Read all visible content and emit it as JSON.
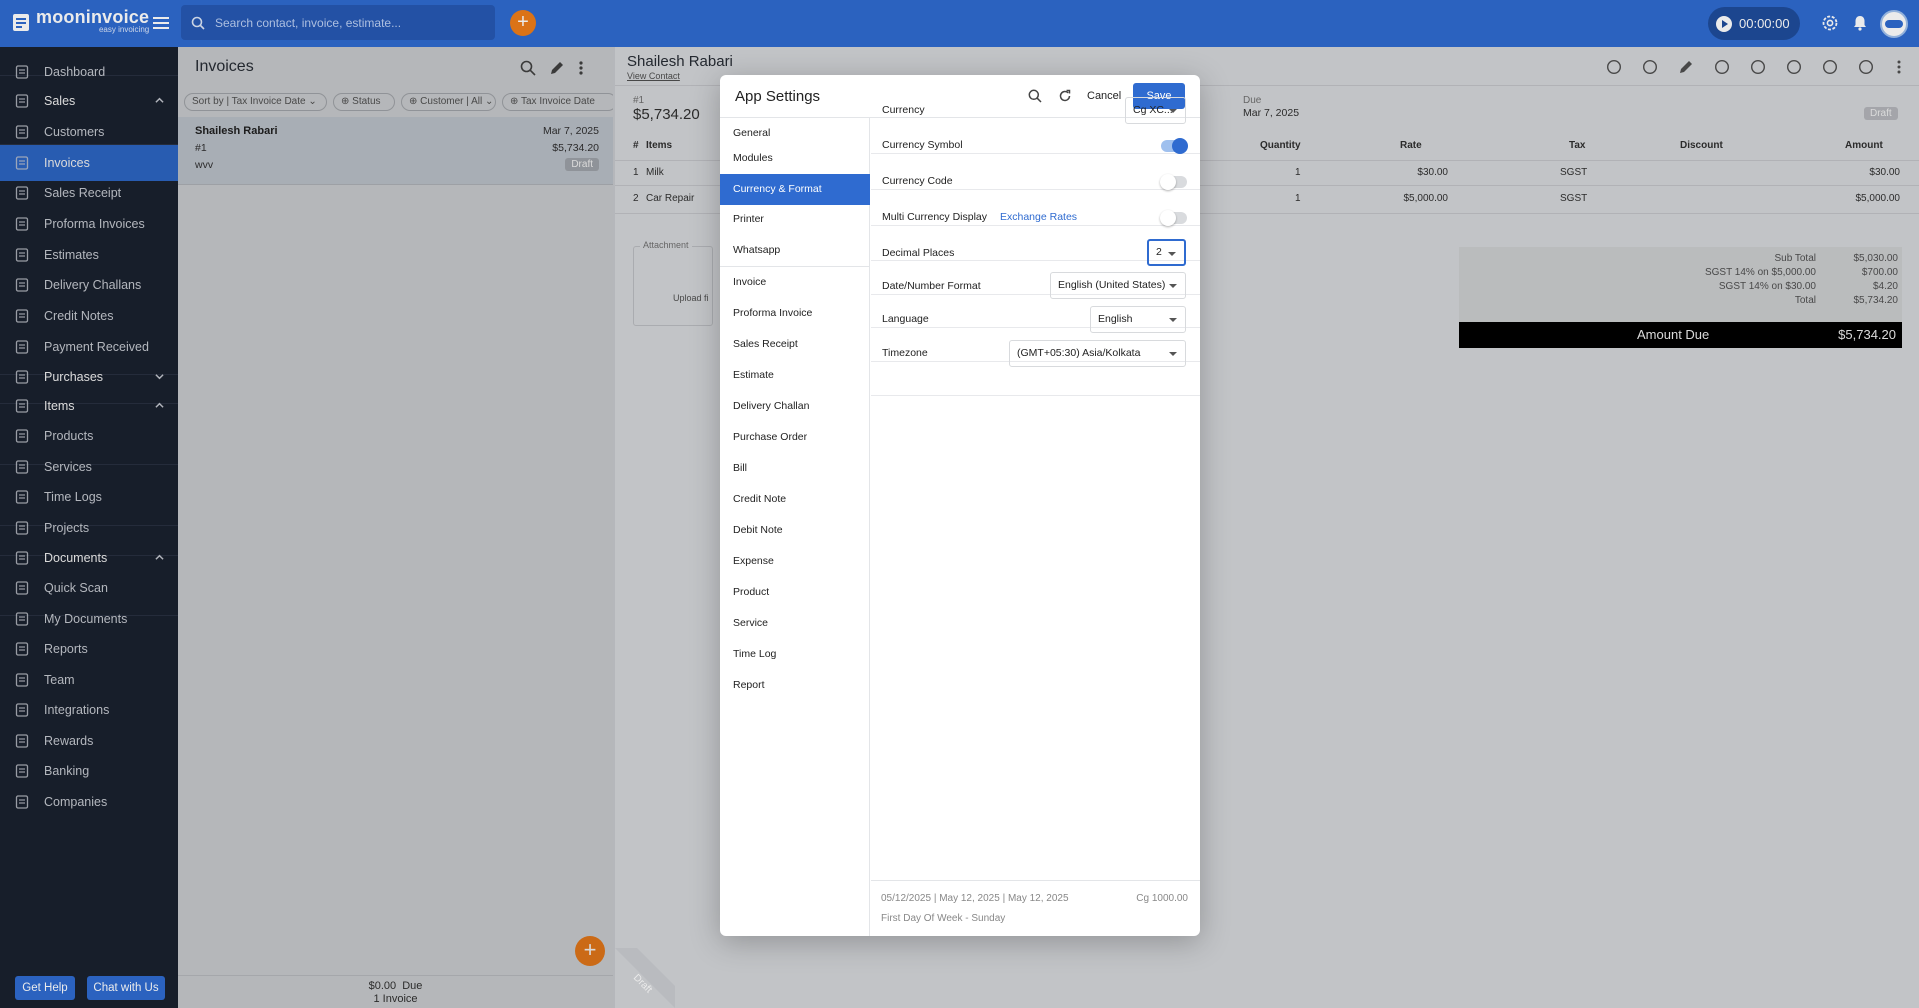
{
  "brand": {
    "name": "mooninvoice",
    "tagline": "easy invoicing"
  },
  "topbar": {
    "search_placeholder": "Search contact, invoice, estimate...",
    "add_label": "+",
    "timer": "00:00:00"
  },
  "sidebar": {
    "items": [
      {
        "label": "Dashboard",
        "icon": "home-icon"
      },
      {
        "label": "Sales",
        "icon": "sales-icon",
        "head": true
      },
      {
        "label": "Customers",
        "icon": "customers-icon"
      },
      {
        "label": "Invoices",
        "icon": "invoice-icon",
        "active": true
      },
      {
        "label": "Sales Receipt",
        "icon": "receipt-icon"
      },
      {
        "label": "Proforma Invoices",
        "icon": "proforma-icon"
      },
      {
        "label": "Estimates",
        "icon": "estimate-icon"
      },
      {
        "label": "Delivery Challans",
        "icon": "truck-icon"
      },
      {
        "label": "Credit Notes",
        "icon": "credit-note-icon"
      },
      {
        "label": "Payment Received",
        "icon": "payment-icon"
      },
      {
        "label": "Purchases",
        "icon": "purchases-icon",
        "head": true
      },
      {
        "label": "Items",
        "icon": "items-icon",
        "head": true
      },
      {
        "label": "Products",
        "icon": "product-icon"
      },
      {
        "label": "Services",
        "icon": "service-icon"
      },
      {
        "label": "Time Logs",
        "icon": "clock-icon"
      },
      {
        "label": "Projects",
        "icon": "folder-icon"
      },
      {
        "label": "Documents",
        "icon": "documents-icon",
        "head": true
      },
      {
        "label": "Quick Scan",
        "icon": "scan-icon"
      },
      {
        "label": "My Documents",
        "icon": "file-icon"
      },
      {
        "label": "Reports",
        "icon": "reports-icon"
      },
      {
        "label": "Team",
        "icon": "team-icon"
      },
      {
        "label": "Integrations",
        "icon": "integrations-icon"
      },
      {
        "label": "Rewards",
        "icon": "rewards-icon"
      },
      {
        "label": "Banking",
        "icon": "bank-icon"
      },
      {
        "label": "Companies",
        "icon": "company-icon"
      }
    ],
    "help": "Get Help",
    "chat": "Chat with Us"
  },
  "list": {
    "title": "Invoices",
    "filters": [
      "Sort by | Tax Invoice Date",
      "Status",
      "Customer | All",
      "Tax Invoice Date"
    ],
    "rows": [
      {
        "name": "Shailesh Rabari",
        "date": "Mar 7, 2025",
        "number": "#1",
        "amount": "$5,734.20",
        "note": "wvv",
        "status": "Draft"
      }
    ],
    "footer_amount": "$0.00",
    "footer_due": "Due",
    "footer_count": "1 Invoice"
  },
  "detail": {
    "customer": "Shailesh Rabari",
    "view_contact": "View Contact",
    "number": "#1",
    "amount": "$5,734.20",
    "due_label": "Due",
    "due_date": "Mar 7, 2025",
    "status": "Draft",
    "columns": [
      "#",
      "Items",
      "Quantity",
      "Rate",
      "Tax",
      "Discount",
      "Amount"
    ],
    "lines": [
      {
        "n": "1",
        "item": "Milk",
        "qty": "1",
        "rate": "$30.00",
        "tax": "SGST",
        "amount": "$30.00"
      },
      {
        "n": "2",
        "item": "Car Repair",
        "qty": "1",
        "rate": "$5,000.00",
        "tax": "SGST",
        "amount": "$5,000.00"
      }
    ],
    "attachment": "Attachment",
    "upload": "Upload fi",
    "totals": [
      {
        "label": "Sub Total",
        "value": "$5,030.00"
      },
      {
        "label": "SGST 14% on $5,000.00",
        "value": "$700.00"
      },
      {
        "label": "SGST 14% on $30.00",
        "value": "$4.20"
      },
      {
        "label": "Total",
        "value": "$5,734.20"
      }
    ],
    "amount_due_label": "Amount Due",
    "amount_due": "$5,734.20",
    "draft_ribbon": "Draft"
  },
  "modal": {
    "title": "App Settings",
    "cancel": "Cancel",
    "save": "Save",
    "nav": [
      "General",
      "Modules",
      "Currency & Format",
      "Printer",
      "Whatsapp",
      "Invoice",
      "Proforma Invoice",
      "Sales Receipt",
      "Estimate",
      "Delivery Challan",
      "Purchase Order",
      "Bill",
      "Credit Note",
      "Debit Note",
      "Expense",
      "Product",
      "Service",
      "Time Log",
      "Report"
    ],
    "active_nav": "Currency & Format",
    "settings": {
      "currency_label": "Currency",
      "currency_value": "Cg XC...",
      "symbol_label": "Currency Symbol",
      "symbol_on": true,
      "code_label": "Currency Code",
      "code_on": false,
      "multi_label": "Multi Currency Display",
      "exchange_link": "Exchange Rates",
      "multi_on": false,
      "decimal_label": "Decimal Places",
      "decimal_value": "2",
      "date_label": "Date/Number Format",
      "date_value": "English (United States)",
      "language_label": "Language",
      "language_value": "English",
      "timezone_label": "Timezone",
      "timezone_value": "(GMT+05:30) Asia/Kolkata"
    },
    "footer_dates": "05/12/2025 | May 12, 2025 | May 12, 2025",
    "footer_amount": "Cg 1000.00",
    "footer_week": "First Day Of Week - Sunday"
  },
  "colors": {
    "primary": "#2f6bd0",
    "accent": "#ee7d1a",
    "sidebar": "#1c2331"
  }
}
